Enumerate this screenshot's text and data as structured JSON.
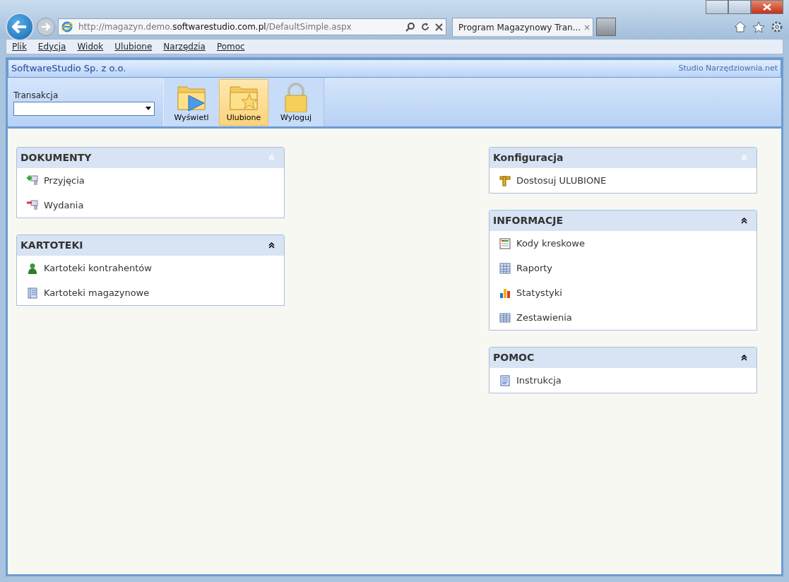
{
  "browser": {
    "url_prefix": "http://magazyn.demo.",
    "url_domain": "softwarestudio.com.pl",
    "url_suffix": "/DefaultSimple.aspx",
    "tab_title": "Program Magazynowy Tran...",
    "tab_close": "×"
  },
  "menu": [
    "Plik",
    "Edycja",
    "Widok",
    "Ulubione",
    "Narzędzia",
    "Pomoc"
  ],
  "app": {
    "company": "SoftwareStudio Sp. z o.o.",
    "brand": "Studio Narzędziownia.net"
  },
  "transaction": {
    "label": "Transakcja"
  },
  "toolbar": [
    {
      "label": "Wyświetl",
      "kind": "show",
      "selected": false
    },
    {
      "label": "Ulubione",
      "kind": "favorites",
      "selected": true
    },
    {
      "label": "Wyloguj",
      "kind": "logout",
      "selected": false
    }
  ],
  "left_panels": [
    {
      "title": "DOKUMENTY",
      "muted": true,
      "items": [
        {
          "label": "Przyjęcia",
          "kind": "receipt"
        },
        {
          "label": "Wydania",
          "kind": "issue"
        }
      ]
    },
    {
      "title": "KARTOTEKI",
      "muted": false,
      "items": [
        {
          "label": "Kartoteki kontrahentów",
          "kind": "person"
        },
        {
          "label": "Kartoteki magazynowe",
          "kind": "ledger"
        }
      ]
    }
  ],
  "right_panels": [
    {
      "title": "Konfiguracja",
      "muted": true,
      "items": [
        {
          "label": "Dostosuj ULUBIONE",
          "kind": "tool"
        }
      ]
    },
    {
      "title": "INFORMACJE",
      "muted": false,
      "items": [
        {
          "label": "Kody kreskowe",
          "kind": "window"
        },
        {
          "label": "Raporty",
          "kind": "grid"
        },
        {
          "label": "Statystyki",
          "kind": "chart"
        },
        {
          "label": "Zestawienia",
          "kind": "table"
        }
      ]
    },
    {
      "title": "POMOC",
      "muted": false,
      "items": [
        {
          "label": "Instrukcja",
          "kind": "doc"
        }
      ]
    }
  ]
}
